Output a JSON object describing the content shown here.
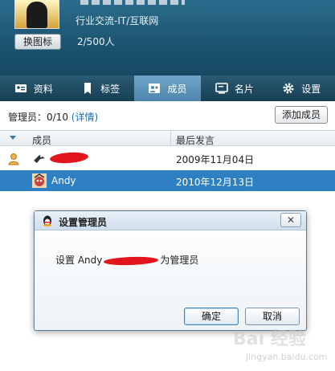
{
  "header": {
    "category": "行业交流-IT/互联网",
    "change_avatar_label": "换图标",
    "member_count": "2/500人"
  },
  "tabs": [
    {
      "label": "资料",
      "icon": "id-card-icon"
    },
    {
      "label": "标签",
      "icon": "bookmark-icon"
    },
    {
      "label": "成员",
      "icon": "members-icon",
      "active": true
    },
    {
      "label": "名片",
      "icon": "card-icon"
    },
    {
      "label": "设置",
      "icon": "gear-icon"
    }
  ],
  "admin": {
    "label": "管理员：0/10",
    "detail_link": "(详情)",
    "add_member_label": "添加成员"
  },
  "table": {
    "col_member": "成员",
    "col_last_speak": "最后发言",
    "rows": [
      {
        "name": "",
        "date": "2009年11月04日"
      },
      {
        "name": "Andy",
        "date": "2010年12月13日"
      }
    ]
  },
  "dialog": {
    "title": "设置管理员",
    "message_prefix": "设置 Andy",
    "message_suffix": "为管理员",
    "ok_label": "确定",
    "cancel_label": "取消",
    "close_label": "✕"
  },
  "watermark": {
    "text": "Bai 经验",
    "url": "jingyan.baidu.com"
  },
  "colors": {
    "header_bg": "#19506c",
    "tab_active": "#5a93b9",
    "selected_row": "#2e80c2",
    "link": "#1a6fb2"
  }
}
